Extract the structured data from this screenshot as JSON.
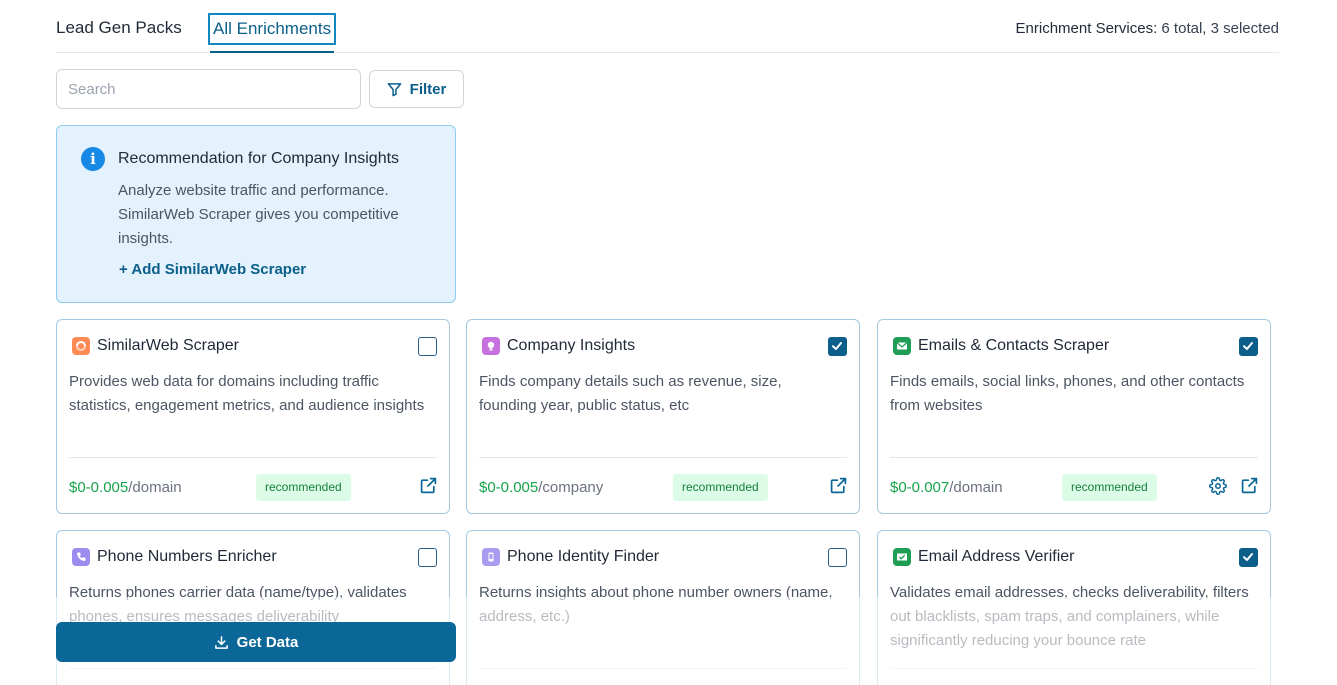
{
  "tabs": {
    "lead_gen": "Lead Gen Packs",
    "all_enrichments": "All Enrichments"
  },
  "summary": {
    "label": "Enrichment Services:",
    "value": "6 total, 3 selected"
  },
  "search": {
    "placeholder": "Search",
    "value": ""
  },
  "filter": {
    "label": "Filter"
  },
  "recommendation": {
    "title_prefix": "Recommendation for",
    "title_target": "Company Insights",
    "description": "Analyze website traffic and performance. SimilarWeb Scraper gives you competitive insights.",
    "action": "+ Add SimilarWeb Scraper"
  },
  "cards": [
    {
      "name": "SimilarWeb Scraper",
      "icon": "similarweb-icon",
      "checked": false,
      "description": "Provides web data for domains including traffic statistics, engagement metrics, and audience insights",
      "price": "$0-0.005",
      "unit": "/domain",
      "badge": "recommended"
    },
    {
      "name": "Company Insights",
      "icon": "lightbulb-icon",
      "checked": true,
      "description": "Finds company details such as revenue, size, founding year, public status, etc",
      "price": "$0-0.005",
      "unit": "/company",
      "badge": "recommended"
    },
    {
      "name": "Emails & Contacts Scraper",
      "icon": "envelope-icon",
      "checked": true,
      "description": "Finds emails, social links, phones, and other contacts from websites",
      "price": "$0-0.007",
      "unit": "/domain",
      "badge": "recommended"
    },
    {
      "name": "Phone Numbers Enricher",
      "icon": "phone-icon",
      "checked": false,
      "description": "Returns phones carrier data (name/type), validates phones, ensures messages deliverability"
    },
    {
      "name": "Phone Identity Finder",
      "icon": "mobile-icon",
      "checked": false,
      "description": "Returns insights about phone number owners (name, address, etc.)"
    },
    {
      "name": "Email Address Verifier",
      "icon": "email-verify-icon",
      "checked": true,
      "description": "Validates email addresses, checks deliverability, filters out blacklists, spam traps, and complainers, while significantly reducing your bounce rate"
    }
  ],
  "get_data": {
    "label": "Get Data"
  },
  "colors": {
    "accent": "#0b5f8a",
    "price": "#16a34a",
    "badge_bg": "#dcfce7",
    "reco_bg": "#e3f2fc"
  }
}
